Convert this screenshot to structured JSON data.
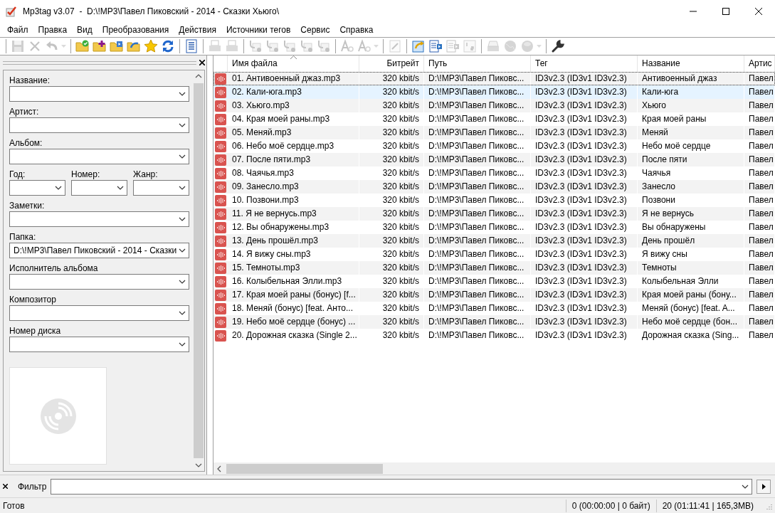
{
  "window": {
    "title": "Mp3tag v3.07  -  D:\\!MP3\\Павел Пиковский - 2014 - Сказки Хьюго\\"
  },
  "menu": [
    "Файл",
    "Правка",
    "Вид",
    "Преобразования",
    "Действия",
    "Источники тегов",
    "Сервис",
    "Справка"
  ],
  "toolbar": [
    {
      "kind": "button",
      "disabled": true,
      "has_menu": false
    },
    {
      "kind": "button",
      "disabled": true,
      "has_menu": false
    },
    {
      "kind": "button",
      "disabled": true,
      "has_menu": true
    },
    {
      "kind": "separator"
    },
    {
      "kind": "button",
      "disabled": false,
      "has_menu": false
    },
    {
      "kind": "button",
      "disabled": false,
      "has_menu": false
    },
    {
      "kind": "button",
      "disabled": false,
      "has_menu": false
    },
    {
      "kind": "button",
      "disabled": false,
      "has_menu": false
    },
    {
      "kind": "button",
      "disabled": false,
      "has_menu": false
    },
    {
      "kind": "button",
      "disabled": false,
      "has_menu": false
    },
    {
      "kind": "separator"
    },
    {
      "kind": "button",
      "disabled": false,
      "has_menu": false
    },
    {
      "kind": "separator"
    },
    {
      "kind": "button",
      "disabled": true,
      "has_menu": false
    },
    {
      "kind": "button",
      "disabled": true,
      "has_menu": false
    },
    {
      "kind": "separator"
    },
    {
      "kind": "button",
      "disabled": true,
      "has_menu": false
    },
    {
      "kind": "button",
      "disabled": true,
      "has_menu": false
    },
    {
      "kind": "button",
      "disabled": true,
      "has_menu": false
    },
    {
      "kind": "button",
      "disabled": true,
      "has_menu": false
    },
    {
      "kind": "button",
      "disabled": true,
      "has_menu": false
    },
    {
      "kind": "separator"
    },
    {
      "kind": "button",
      "disabled": true,
      "has_menu": false
    },
    {
      "kind": "button",
      "disabled": true,
      "has_menu": true
    },
    {
      "kind": "separator"
    },
    {
      "kind": "button",
      "disabled": true,
      "has_menu": false
    },
    {
      "kind": "separator"
    },
    {
      "kind": "button",
      "disabled": false,
      "has_menu": false
    },
    {
      "kind": "button",
      "disabled": false,
      "has_menu": false
    },
    {
      "kind": "button",
      "disabled": true,
      "has_menu": false
    },
    {
      "kind": "button",
      "disabled": true,
      "has_menu": false
    },
    {
      "kind": "separator"
    },
    {
      "kind": "button",
      "disabled": true,
      "has_menu": false
    },
    {
      "kind": "button",
      "disabled": true,
      "has_menu": false
    },
    {
      "kind": "button",
      "disabled": true,
      "has_menu": true
    },
    {
      "kind": "separator"
    },
    {
      "kind": "button",
      "disabled": false,
      "has_menu": false
    }
  ],
  "tag_panel": {
    "rows": [
      [
        {
          "label": "Название:"
        }
      ],
      [
        {
          "label": "Артист:"
        }
      ],
      [
        {
          "label": "Альбом:"
        }
      ],
      [
        {
          "label": "Год:"
        },
        {
          "label": "Номер:"
        },
        {
          "label": "Жанр:"
        }
      ],
      [
        {
          "label": "Заметки:"
        }
      ],
      [
        {
          "label": "Папка:",
          "value": "D:\\!MP3\\Павел Пиковский - 2014 - Сказки"
        }
      ],
      [
        {
          "label": "Исполнитель альбома"
        }
      ],
      [
        {
          "label": "Композитор"
        }
      ],
      [
        {
          "label": "Номер диска"
        }
      ]
    ]
  },
  "table": {
    "columns": [
      {
        "label": "Имя файла",
        "sorted": true,
        "kind": "text"
      },
      {
        "label": "Битрейт",
        "sorted": false,
        "kind": "number"
      },
      {
        "label": "Путь",
        "sorted": false,
        "kind": "text"
      },
      {
        "label": "Тег",
        "sorted": false,
        "kind": "text"
      },
      {
        "label": "Название",
        "sorted": false,
        "kind": "text"
      },
      {
        "label": "Артис",
        "sorted": false,
        "kind": "text"
      }
    ],
    "rows": [
      {
        "selected": false,
        "focused": true,
        "cells": [
          "01. Антивоенный джаз.mp3",
          "320 kbit/s",
          "D:\\!MP3\\Павел Пиковс...",
          "ID3v2.3 (ID3v1 ID3v2.3)",
          "Антивоенный джаз",
          "Павел"
        ]
      },
      {
        "selected": true,
        "focused": false,
        "cells": [
          "02. Кали-юга.mp3",
          "320 kbit/s",
          "D:\\!MP3\\Павел Пиковс...",
          "ID3v2.3 (ID3v1 ID3v2.3)",
          "Кали-юга",
          "Павел"
        ]
      },
      {
        "selected": false,
        "focused": false,
        "cells": [
          "03. Хьюго.mp3",
          "320 kbit/s",
          "D:\\!MP3\\Павел Пиковс...",
          "ID3v2.3 (ID3v1 ID3v2.3)",
          "Хьюго",
          "Павел"
        ]
      },
      {
        "selected": false,
        "focused": false,
        "cells": [
          "04. Края моей раны.mp3",
          "320 kbit/s",
          "D:\\!MP3\\Павел Пиковс...",
          "ID3v2.3 (ID3v1 ID3v2.3)",
          "Края моей раны",
          "Павел"
        ]
      },
      {
        "selected": false,
        "focused": false,
        "cells": [
          "05. Меняй.mp3",
          "320 kbit/s",
          "D:\\!MP3\\Павел Пиковс...",
          "ID3v2.3 (ID3v1 ID3v2.3)",
          "Меняй",
          "Павел"
        ]
      },
      {
        "selected": false,
        "focused": false,
        "cells": [
          "06. Небо моё сердце.mp3",
          "320 kbit/s",
          "D:\\!MP3\\Павел Пиковс...",
          "ID3v2.3 (ID3v1 ID3v2.3)",
          "Небо моё сердце",
          "Павел"
        ]
      },
      {
        "selected": false,
        "focused": false,
        "cells": [
          "07. После пяти.mp3",
          "320 kbit/s",
          "D:\\!MP3\\Павел Пиковс...",
          "ID3v2.3 (ID3v1 ID3v2.3)",
          "После пяти",
          "Павел"
        ]
      },
      {
        "selected": false,
        "focused": false,
        "cells": [
          "08. Чаячья.mp3",
          "320 kbit/s",
          "D:\\!MP3\\Павел Пиковс...",
          "ID3v2.3 (ID3v1 ID3v2.3)",
          "Чаячья",
          "Павел"
        ]
      },
      {
        "selected": false,
        "focused": false,
        "cells": [
          "09. Занесло.mp3",
          "320 kbit/s",
          "D:\\!MP3\\Павел Пиковс...",
          "ID3v2.3 (ID3v1 ID3v2.3)",
          "Занесло",
          "Павел"
        ]
      },
      {
        "selected": false,
        "focused": false,
        "cells": [
          "10. Позвони.mp3",
          "320 kbit/s",
          "D:\\!MP3\\Павел Пиковс...",
          "ID3v2.3 (ID3v1 ID3v2.3)",
          "Позвони",
          "Павел"
        ]
      },
      {
        "selected": false,
        "focused": false,
        "cells": [
          "11. Я не вернусь.mp3",
          "320 kbit/s",
          "D:\\!MP3\\Павел Пиковс...",
          "ID3v2.3 (ID3v1 ID3v2.3)",
          "Я не вернусь",
          "Павел"
        ]
      },
      {
        "selected": false,
        "focused": false,
        "cells": [
          "12. Вы обнаружены.mp3",
          "320 kbit/s",
          "D:\\!MP3\\Павел Пиковс...",
          "ID3v2.3 (ID3v1 ID3v2.3)",
          "Вы обнаружены",
          "Павел"
        ]
      },
      {
        "selected": false,
        "focused": false,
        "cells": [
          "13. День прошёл.mp3",
          "320 kbit/s",
          "D:\\!MP3\\Павел Пиковс...",
          "ID3v2.3 (ID3v1 ID3v2.3)",
          "День прошёл",
          "Павел"
        ]
      },
      {
        "selected": false,
        "focused": false,
        "cells": [
          "14. Я вижу сны.mp3",
          "320 kbit/s",
          "D:\\!MP3\\Павел Пиковс...",
          "ID3v2.3 (ID3v1 ID3v2.3)",
          "Я вижу сны",
          "Павел"
        ]
      },
      {
        "selected": false,
        "focused": false,
        "cells": [
          "15. Темноты.mp3",
          "320 kbit/s",
          "D:\\!MP3\\Павел Пиковс...",
          "ID3v2.3 (ID3v1 ID3v2.3)",
          "Темноты",
          "Павел"
        ]
      },
      {
        "selected": false,
        "focused": false,
        "cells": [
          "16. Колыбельная Элли.mp3",
          "320 kbit/s",
          "D:\\!MP3\\Павел Пиковс...",
          "ID3v2.3 (ID3v1 ID3v2.3)",
          "Колыбельная Элли",
          "Павел"
        ]
      },
      {
        "selected": false,
        "focused": false,
        "cells": [
          "17. Края моей раны (бонус) [f...",
          "320 kbit/s",
          "D:\\!MP3\\Павел Пиковс...",
          "ID3v2.3 (ID3v1 ID3v2.3)",
          "Края моей раны (бону...",
          "Павел"
        ]
      },
      {
        "selected": false,
        "focused": false,
        "cells": [
          "18. Меняй (бонус) [feat. Анто...",
          "320 kbit/s",
          "D:\\!MP3\\Павел Пиковс...",
          "ID3v2.3 (ID3v1 ID3v2.3)",
          "Меняй (бонус) [feat. A...",
          "Павел"
        ]
      },
      {
        "selected": false,
        "focused": false,
        "cells": [
          "19. Небо моё сердце (бонус) ...",
          "320 kbit/s",
          "D:\\!MP3\\Павел Пиковс...",
          "ID3v2.3 (ID3v1 ID3v2.3)",
          "Небо моё сердце (бон...",
          "Павел"
        ]
      },
      {
        "selected": false,
        "focused": false,
        "cells": [
          "20. Дорожная сказка (Single 2...",
          "320 kbit/s",
          "D:\\!MP3\\Павел Пиковс...",
          "ID3v2.3 (ID3v1 ID3v2.3)",
          "Дорожная сказка (Sing...",
          "Павел"
        ]
      }
    ]
  },
  "filter": {
    "label": "Фильтр"
  },
  "status_bar": {
    "message": "Готов",
    "selection": "0 (00:00:00 | 0 байт)",
    "total": "20 (01:11:41 | 165,3MB)"
  }
}
